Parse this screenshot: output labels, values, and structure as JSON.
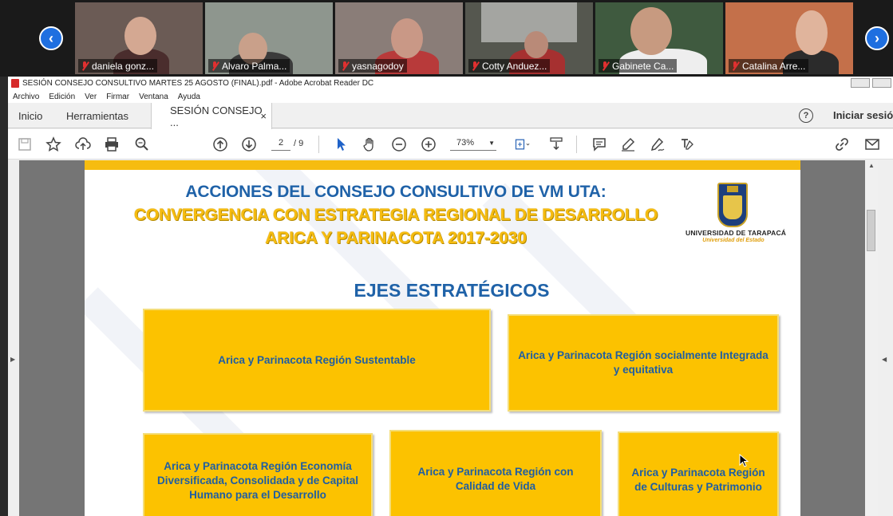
{
  "participants": [
    {
      "name": "daniela gonz...",
      "bg": "#6b5b55"
    },
    {
      "name": "Alvaro Palma...",
      "bg": "#7f8a82"
    },
    {
      "name": "yasnagodoy",
      "bg": "#8a7d78"
    },
    {
      "name": "Cotty Anduez...",
      "bg": "#55574f"
    },
    {
      "name": "Gabinete Ca...",
      "bg": "#3f5a3f"
    },
    {
      "name": "Catalina Arre...",
      "bg": "#c4704a"
    }
  ],
  "window": {
    "title": "SESIÓN CONSEJO CONSULTIVO MARTES 25 AGOSTO (FINAL).pdf - Adobe Acrobat Reader DC"
  },
  "menu": [
    "Archivo",
    "Edición",
    "Ver",
    "Firmar",
    "Ventana",
    "Ayuda"
  ],
  "tabs": {
    "home": "Inicio",
    "tools": "Herramientas",
    "document": "SESIÓN CONSEJO ...",
    "close": "×",
    "help": "?",
    "signin": "Iniciar sesión"
  },
  "toolbar": {
    "page_current": "2",
    "page_total": "/ 9",
    "zoom": "73%"
  },
  "document": {
    "title_line1": "ACCIONES DEL CONSEJO CONSULTIVO DE VM UTA:",
    "title_line2": "CONVERGENCIA CON ESTRATEGIA REGIONAL DE DESARROLLO",
    "title_line3": "ARICA Y PARINACOTA 2017-2030",
    "logo_name": "UNIVERSIDAD DE TARAPACÁ",
    "logo_sub": "Universidad del Estado",
    "section": "EJES ESTRATÉGICOS",
    "axes": [
      "Arica y Parinacota Región Sustentable",
      "Arica y Parinacota Región socialmente Integrada y equitativa",
      "Arica y Parinacota Región Economía Diversificada, Consolidada y de Capital Humano para el Desarrollo",
      "Arica y Parinacota Región con Calidad de Vida",
      "Arica y Parinacota Región de Culturas y Patrimonio"
    ]
  },
  "colors": {
    "accent_blue": "#1f62a8",
    "accent_yellow": "#fcc200",
    "zoom_nav": "#1f6fe0"
  }
}
